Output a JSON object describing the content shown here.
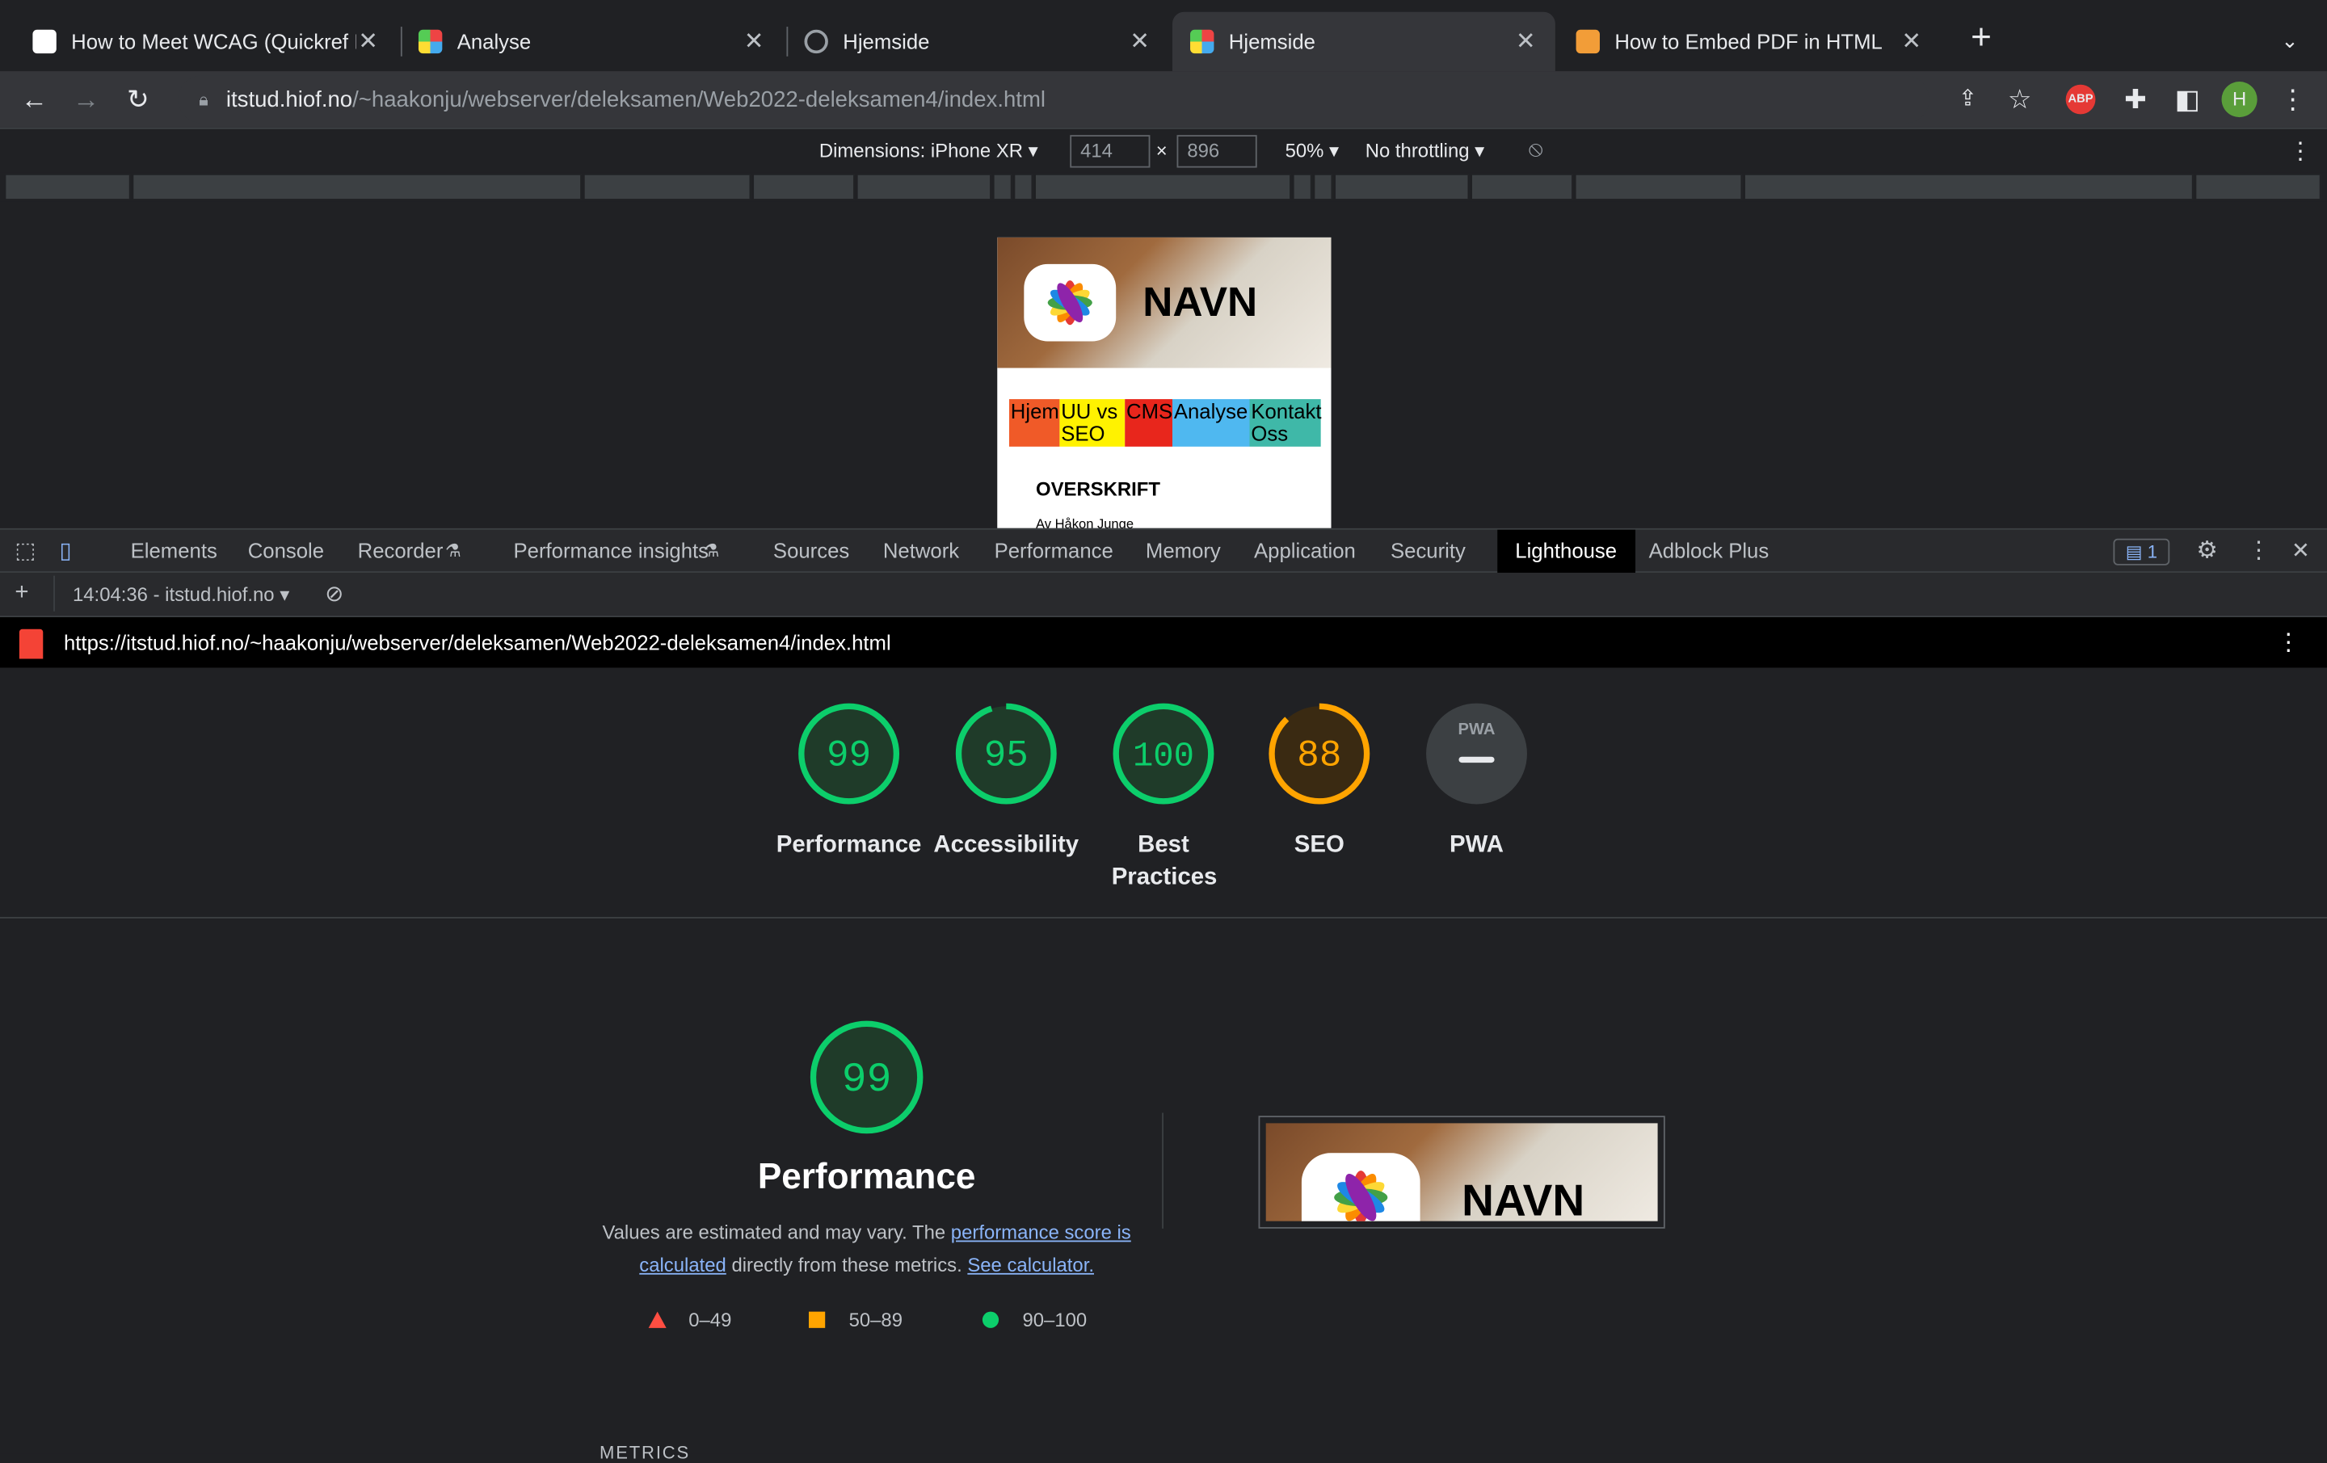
{
  "browser": {
    "tabs": [
      {
        "title": "How to Meet WCAG (Quickref R",
        "favicon": "w3c-icon",
        "active": false
      },
      {
        "title": "Analyse",
        "favicon": "app-icon",
        "active": false
      },
      {
        "title": "Hjemside",
        "favicon": "globe-icon",
        "active": false
      },
      {
        "title": "Hjemside",
        "favicon": "app-icon",
        "active": true
      },
      {
        "title": "How to Embed PDF in HTML",
        "favicon": "w3docs-icon",
        "active": false
      }
    ],
    "url_host": "itstud.hiof.no",
    "url_path": "/~haakonju/webserver/deleksamen/Web2022-deleksamen4/index.html",
    "profile_initial": "H",
    "abp_label": "ABP"
  },
  "device_toolbar": {
    "dimensions_label": "Dimensions: iPhone XR",
    "width": "414",
    "height": "896",
    "times": "×",
    "zoom": "50%",
    "throttling": "No throttling"
  },
  "preview": {
    "brand": "NAVN",
    "nav": [
      "Hjem",
      "UU vs SEO",
      "CMS",
      "Analyse",
      "Kontakt Oss"
    ],
    "nav_colors": [
      "#f05a28",
      "#fff200",
      "#e8261c",
      "#4fb8f0",
      "#3fb8a8"
    ],
    "heading": "OVERSKRIFT",
    "byline": "Av Håkon Junge"
  },
  "devtools": {
    "tabs": [
      "Elements",
      "Console",
      "Recorder",
      "Performance insights",
      "Sources",
      "Network",
      "Performance",
      "Memory",
      "Application",
      "Security",
      "Lighthouse",
      "Adblock Plus"
    ],
    "active_tab": "Lighthouse",
    "issues_count": "1",
    "report_selector": "14:04:36 - itstud.hiof.no",
    "report_url": "https://itstud.hiof.no/~haakonju/webserver/deleksamen/Web2022-deleksamen4/index.html"
  },
  "lighthouse": {
    "scores": [
      {
        "label": "Performance",
        "value": "99",
        "fraction": 0.99,
        "color": "#0cce6b"
      },
      {
        "label": "Accessibility",
        "value": "95",
        "fraction": 0.95,
        "color": "#0cce6b"
      },
      {
        "label": "Best Practices",
        "value": "100",
        "fraction": 1.0,
        "color": "#0cce6b"
      },
      {
        "label": "SEO",
        "value": "88",
        "fraction": 0.88,
        "color": "#ffa400"
      },
      {
        "label": "PWA",
        "value": "PWA",
        "fraction": 0,
        "color": "#9aa0a6"
      }
    ],
    "detail_score": "99",
    "detail_title": "Performance",
    "desc_1": "Values are estimated and may vary. The ",
    "desc_link1": "performance score is calculated",
    "desc_2": " directly from these metrics. ",
    "desc_link2": "See calculator.",
    "legend": [
      "0–49",
      "50–89",
      "90–100"
    ],
    "legend_colors": [
      "#ff4e42",
      "#ffa400",
      "#0cce6b"
    ],
    "metrics_heading": "METRICS",
    "thumb_brand": "NAVN"
  }
}
